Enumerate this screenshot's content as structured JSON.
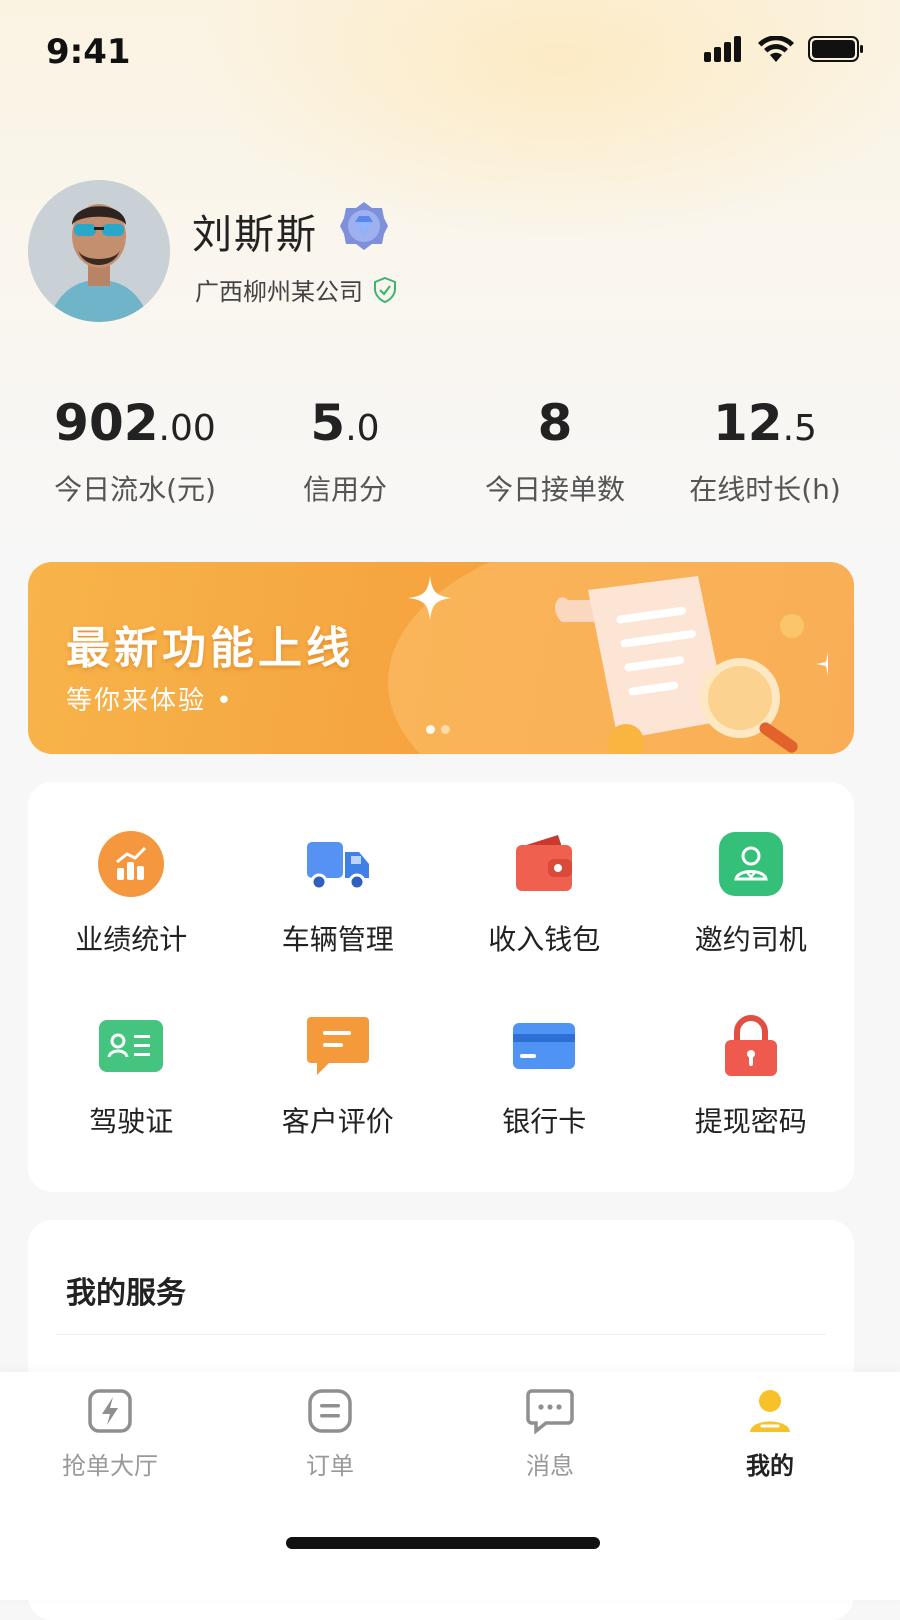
{
  "status_bar": {
    "time": "9:41"
  },
  "profile": {
    "name": "刘斯斯",
    "company": "广西柳州某公司"
  },
  "stats": [
    {
      "int": "902",
      "dec": ".00",
      "label": "今日流水(元)"
    },
    {
      "int": "5",
      "dec": ".0",
      "label": "信用分"
    },
    {
      "int": "8",
      "dec": "",
      "label": "今日接单数"
    },
    {
      "int": "12",
      "dec": ".5",
      "label": "在线时长(h)"
    }
  ],
  "banner": {
    "title": "最新功能上线",
    "subtitle": "等你来体验 •"
  },
  "menu": [
    {
      "label": "业绩统计",
      "icon": "chart-icon",
      "color": "#f5973e"
    },
    {
      "label": "车辆管理",
      "icon": "truck-icon",
      "color": "#4d8ef3"
    },
    {
      "label": "收入钱包",
      "icon": "wallet-icon",
      "color": "#f0604f"
    },
    {
      "label": "邀约司机",
      "icon": "invite-driver-icon",
      "color": "#35c07a"
    },
    {
      "label": "驾驶证",
      "icon": "license-card-icon",
      "color": "#45c47f"
    },
    {
      "label": "客户评价",
      "icon": "comment-icon",
      "color": "#f59a3a"
    },
    {
      "label": "银行卡",
      "icon": "bank-card-icon",
      "color": "#3f8cf0"
    },
    {
      "label": "提现密码",
      "icon": "lock-icon",
      "color": "#ef5a4e"
    }
  ],
  "services": {
    "title": "我的服务"
  },
  "tabbar": [
    {
      "label": "抢单大厅",
      "icon": "lightning-icon",
      "active": false
    },
    {
      "label": "订单",
      "icon": "order-icon",
      "active": false
    },
    {
      "label": "消息",
      "icon": "message-icon",
      "active": false
    },
    {
      "label": "我的",
      "icon": "user-icon",
      "active": true
    }
  ]
}
